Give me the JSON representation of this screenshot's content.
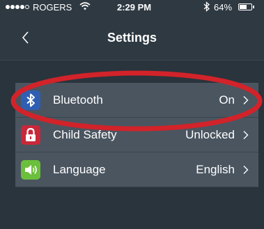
{
  "status_bar": {
    "signal_bars_filled": 4,
    "signal_bars_total": 5,
    "carrier": "ROGERS",
    "time": "2:29 PM",
    "battery_percent": "64%",
    "battery_level": 0.64
  },
  "nav": {
    "title": "Settings",
    "back_icon": "chevron-left-icon"
  },
  "settings": [
    {
      "id": "bluetooth",
      "label": "Bluetooth",
      "value": "On",
      "icon": "bluetooth-icon",
      "icon_color": "#2f5fb3"
    },
    {
      "id": "child-safety",
      "label": "Child Safety",
      "value": "Unlocked",
      "icon": "lock-icon",
      "icon_color": "#c9283a"
    },
    {
      "id": "language",
      "label": "Language",
      "value": "English",
      "icon": "speaker-icon",
      "icon_color": "#6cbf3c"
    }
  ],
  "annotation": {
    "shape": "ellipse",
    "color": "#d2232a",
    "highlights": "bluetooth"
  }
}
